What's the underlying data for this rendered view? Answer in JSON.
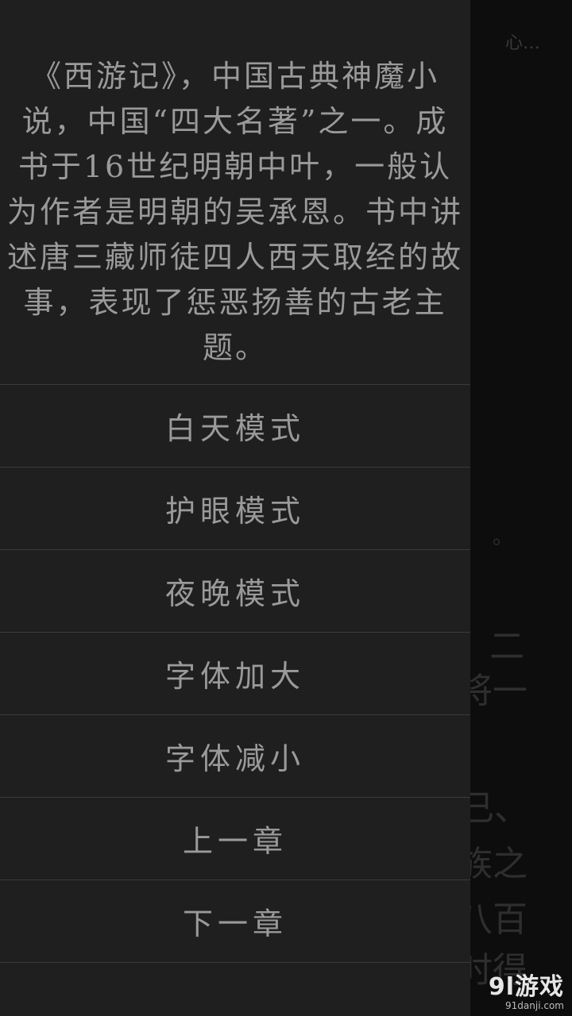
{
  "reader": {
    "header_text": "心…",
    "fragments": [
      "。",
      "二",
      "将一",
      "已、",
      "族之",
      "八百",
      "时得"
    ]
  },
  "drawer": {
    "intro": "《西游记》，中国古典神魔小说，中国“四大名著”之一。成书于16世纪明朝中叶，一般认为作者是明朝的吴承恩。书中讲述唐三藏师徒四人西天取经的故事，表现了惩恶扬善的古老主题。",
    "menu": [
      {
        "label": "白天模式"
      },
      {
        "label": "护眼模式"
      },
      {
        "label": "夜晚模式"
      },
      {
        "label": "字体加大"
      },
      {
        "label": "字体减小"
      },
      {
        "label": "上一章"
      },
      {
        "label": "下一章"
      }
    ]
  },
  "watermark": {
    "logo": "9l游戏",
    "url": "91danji.com"
  }
}
